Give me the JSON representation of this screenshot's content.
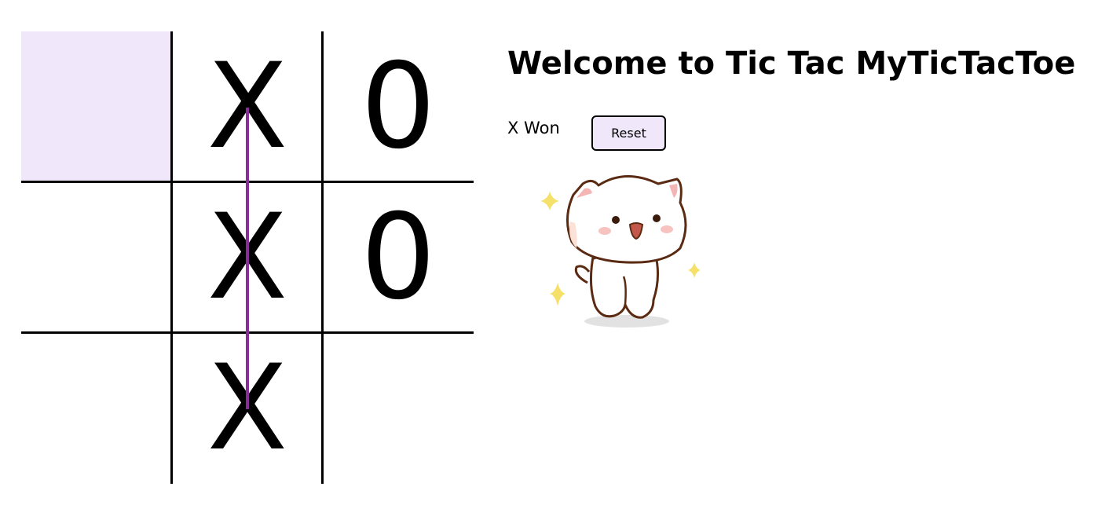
{
  "game": {
    "title": "Welcome to Tic Tac MyTicTacToe",
    "status": "X Won",
    "reset_label": "Reset",
    "board": [
      "",
      "X",
      "0",
      "",
      "X",
      "0",
      "",
      "X",
      ""
    ],
    "highlighted_cell": 0,
    "winning_line": [
      1,
      4,
      7
    ]
  },
  "colors": {
    "cell_highlight": "#f0e8fa",
    "win_line": "#8a2c9a",
    "grid": "#000000",
    "button_bg": "#f0e8fa"
  },
  "illustration": {
    "icon": "happy-cat-sticker-icon"
  }
}
